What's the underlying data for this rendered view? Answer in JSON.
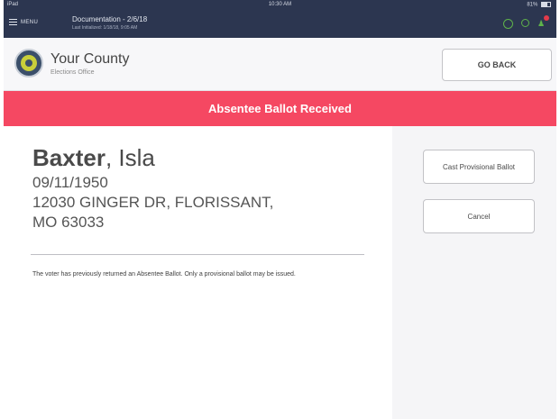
{
  "status_bar": {
    "carrier": "iPad",
    "time": "10:30 AM",
    "battery": "81%"
  },
  "app_bar": {
    "menu_label": "MENU",
    "doc_title": "Documentation - 2/6/18",
    "doc_subtitle": "Last Initialized: 1/18/18, 9:05 AM"
  },
  "header": {
    "county_name": "Your County",
    "office_name": "Elections Office",
    "go_back_label": "GO BACK"
  },
  "banner": {
    "text": "Absentee Ballot Received"
  },
  "voter": {
    "last_name": "Baxter",
    "first_name": "Isla",
    "dob": "09/11/1950",
    "address_line1": "12030 GINGER DR, FLORISSANT,",
    "address_line2": "MO 63033"
  },
  "message": "The voter has previously returned an Absentee Ballot. Only a provisional ballot may be issued.",
  "actions": {
    "cast_provisional_label": "Cast Provisional Ballot",
    "cancel_label": "Cancel"
  },
  "colors": {
    "nav_bg": "#2c3650",
    "banner_bg": "#f54862",
    "icon_green": "#5fb34a"
  }
}
